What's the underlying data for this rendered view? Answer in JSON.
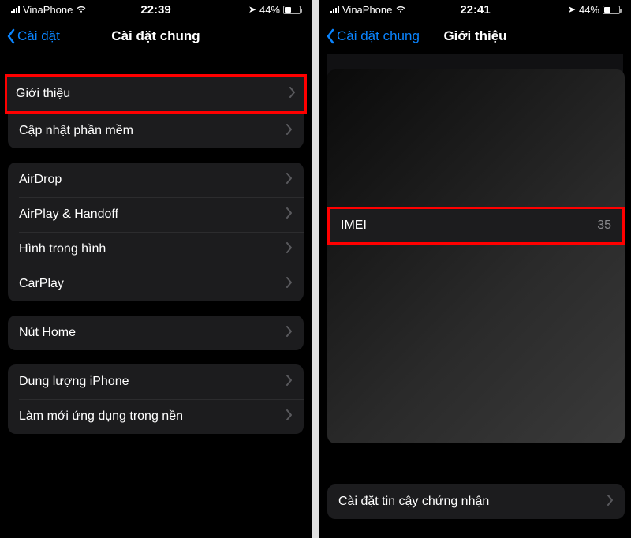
{
  "left": {
    "status": {
      "carrier": "VinaPhone",
      "time": "22:39",
      "battery_pct": "44%"
    },
    "nav": {
      "back_label": "Cài đặt",
      "title": "Cài đặt chung"
    },
    "group1": {
      "about": "Giới thiệu",
      "software_update": "Cập nhật phần mềm"
    },
    "group2": {
      "airdrop": "AirDrop",
      "airplay": "AirPlay & Handoff",
      "pip": "Hình trong hình",
      "carplay": "CarPlay"
    },
    "group3": {
      "home_button": "Nút Home"
    },
    "group4": {
      "storage": "Dung lượng iPhone",
      "background_refresh": "Làm mới ứng dụng trong nền"
    }
  },
  "right": {
    "status": {
      "carrier": "VinaPhone",
      "time": "22:41",
      "battery_pct": "44%"
    },
    "nav": {
      "back_label": "Cài đặt chung",
      "title": "Giới thiệu"
    },
    "imei": {
      "label": "IMEI",
      "value": "35"
    },
    "cert_trust": "Cài đặt tin cậy chứng nhận"
  }
}
